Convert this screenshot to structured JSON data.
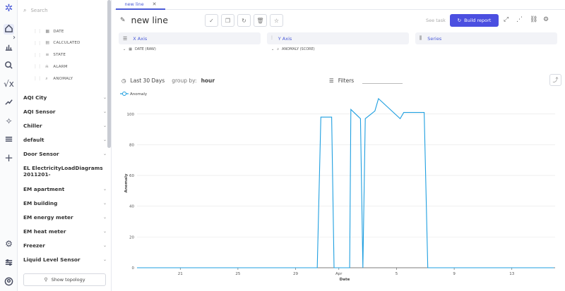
{
  "sidebar": {
    "search_placeholder": "Search",
    "sub_items": [
      {
        "label": "DATE",
        "icon": "calendar-icon"
      },
      {
        "label": "CALCULATED",
        "icon": "grid-icon"
      },
      {
        "label": "STATE",
        "icon": "list-icon"
      },
      {
        "label": "ALARM",
        "icon": "bell-icon"
      },
      {
        "label": "ANOMALY",
        "icon": "magnifier-icon"
      }
    ],
    "groups": [
      "AQI City",
      "AQI Sensor",
      "Chiller",
      "default",
      "Door Sensor",
      "EL ElectricityLoadDiagrams2011201-",
      "EM apartment",
      "EM building",
      "EM energy meter",
      "EM heat meter",
      "Freezer",
      "Liquid Level Sensor"
    ],
    "topology_button": "Show topology"
  },
  "tab": {
    "label": "new line"
  },
  "header": {
    "title": "new line",
    "see_task": "See task",
    "build_report": "Build report"
  },
  "axes": {
    "x": {
      "title": "X Axis",
      "value": "DATE (RAW)"
    },
    "y": {
      "title": "Y Axis",
      "value": "ANOMALY (SCORE)"
    },
    "series": {
      "title": "Series"
    }
  },
  "controls": {
    "range": "Last 30 Days",
    "group_label": "group by:",
    "group_value": "hour",
    "filters": "Filters"
  },
  "colors": {
    "accent": "#4b5bd8",
    "line": "#1f9fe0"
  },
  "chart_data": {
    "type": "line",
    "legend": [
      "Anomaly"
    ],
    "xlabel": "Date",
    "ylabel": "Anomaly",
    "x_ticks": [
      "21",
      "25",
      "29",
      "Apr",
      "5",
      "9",
      "13"
    ],
    "y_ticks": [
      0,
      20,
      40,
      60,
      80,
      100
    ],
    "ylim": [
      0,
      110
    ],
    "grid": true,
    "series": [
      {
        "name": "Anomaly",
        "points": [
          [
            "2024-03-18",
            0
          ],
          [
            "2024-03-30 12:00",
            0
          ],
          [
            "2024-03-30 18:00",
            98
          ],
          [
            "2024-03-31 12:00",
            98
          ],
          [
            "2024-03-31 16:00",
            0
          ],
          [
            "2024-04-01 18:00",
            0
          ],
          [
            "2024-04-01 20:00",
            103
          ],
          [
            "2024-04-02 12:00",
            97
          ],
          [
            "2024-04-02 16:00",
            0
          ],
          [
            "2024-04-02 20:00",
            97
          ],
          [
            "2024-04-03 12:00",
            102
          ],
          [
            "2024-04-03 18:00",
            110
          ],
          [
            "2024-04-05 06:00",
            97
          ],
          [
            "2024-04-05 12:00",
            101
          ],
          [
            "2024-04-06 22:00",
            101
          ],
          [
            "2024-04-07 04:00",
            0
          ],
          [
            "2024-04-15 22:00",
            0
          ]
        ]
      }
    ]
  }
}
